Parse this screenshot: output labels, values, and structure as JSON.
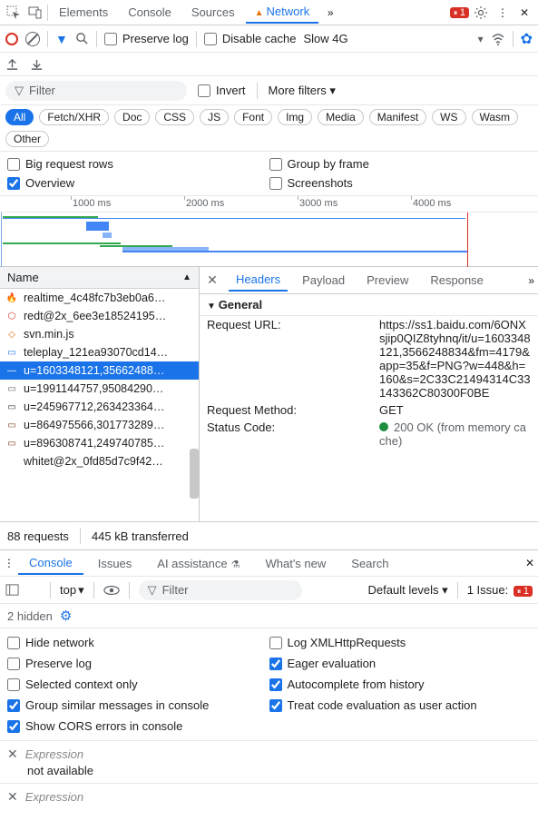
{
  "topbar": {
    "tabs": [
      "Elements",
      "Console",
      "Sources",
      "Network"
    ],
    "active_tab": "Network",
    "error_count": "1"
  },
  "toolbar": {
    "preserve_log": "Preserve log",
    "disable_cache": "Disable cache",
    "throttle": "Slow 4G"
  },
  "filter": {
    "placeholder": "Filter",
    "invert": "Invert",
    "more_filters": "More filters"
  },
  "types": [
    "All",
    "Fetch/XHR",
    "Doc",
    "CSS",
    "JS",
    "Font",
    "Img",
    "Media",
    "Manifest",
    "WS",
    "Wasm",
    "Other"
  ],
  "types_active": "All",
  "opt_rows": {
    "big_rows": "Big request rows",
    "group_frame": "Group by frame",
    "overview": "Overview",
    "screenshots": "Screenshots"
  },
  "timeline": {
    "ticks": [
      "1000 ms",
      "2000 ms",
      "3000 ms",
      "4000 ms"
    ]
  },
  "list": {
    "header": "Name",
    "items": [
      {
        "icon": "🔥",
        "color": "#e8710a",
        "name": "realtime_4c48fc7b3eb0a6…"
      },
      {
        "icon": "⬡",
        "color": "#d93025",
        "name": "redt@2x_6ee3e18524195…"
      },
      {
        "icon": "◇",
        "color": "#e8710a",
        "name": "svn.min.js"
      },
      {
        "icon": "▭",
        "color": "#1a73e8",
        "name": "teleplay_121ea93070cd14…"
      },
      {
        "icon": "—",
        "color": "#fff",
        "name": "u=1603348121,35662488…",
        "selected": true
      },
      {
        "icon": "▭",
        "color": "#5f6368",
        "name": "u=1991144757,95084290…"
      },
      {
        "icon": "▭",
        "color": "#333",
        "name": "u=245967712,263423364…"
      },
      {
        "icon": "▭",
        "color": "#7a3b1d",
        "name": "u=864975566,301773289…"
      },
      {
        "icon": "▭",
        "color": "#7a3b1d",
        "name": "u=896308741,249740785…"
      },
      {
        "icon": "",
        "color": "",
        "name": "whitet@2x_0fd85d7c9f42…"
      }
    ]
  },
  "detail": {
    "tabs": [
      "Headers",
      "Payload",
      "Preview",
      "Response"
    ],
    "active": "Headers",
    "section": "General",
    "request_url_label": "Request URL:",
    "request_url_value": "https://ss1.baidu.com/6ONXsjip0QIZ8tyhnq/it/u=1603348121,3566248834&fm=4179&app=35&f=PNG?w=448&h=160&s=2C33C21494314C33143362C80300F0BE",
    "request_method_label": "Request Method:",
    "request_method_value": "GET",
    "status_code_label": "Status Code:",
    "status_code_value": "200 OK (from memory cache)"
  },
  "status": {
    "requests": "88 requests",
    "transferred": "445 kB transferred"
  },
  "drawer": {
    "tabs": [
      "Console",
      "Issues",
      "AI assistance",
      "What's new",
      "Search"
    ],
    "active": "Console"
  },
  "console": {
    "context": "top",
    "filter_placeholder": "Filter",
    "levels": "Default levels",
    "issue_label": "1 Issue:",
    "issue_count": "1",
    "hidden": "2 hidden",
    "opts": {
      "hide_network": "Hide network",
      "log_xhr": "Log XMLHttpRequests",
      "preserve_log": "Preserve log",
      "eager_eval": "Eager evaluation",
      "sel_ctx": "Selected context only",
      "autocomplete": "Autocomplete from history",
      "group_similar": "Group similar messages in console",
      "treat_code": "Treat code evaluation as user action",
      "show_cors": "Show CORS errors in console"
    },
    "expr_label": "Expression",
    "expr_value": "not available"
  }
}
